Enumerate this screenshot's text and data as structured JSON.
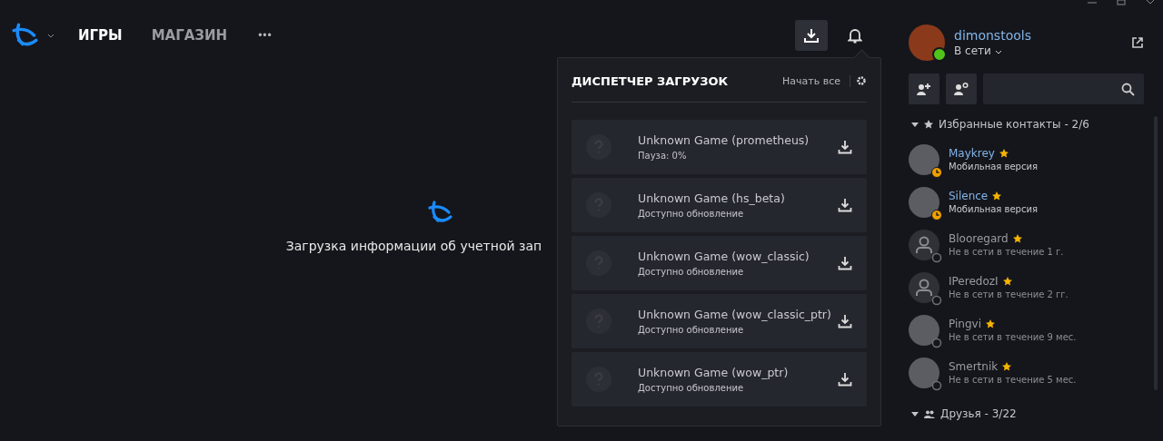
{
  "topbar": {
    "nav": [
      {
        "label": "ИГРЫ",
        "selected": true
      },
      {
        "label": "МАГАЗИН",
        "selected": false
      }
    ],
    "more": "•••"
  },
  "main": {
    "loading_text": "Загрузка информации об учетной зап"
  },
  "download_manager": {
    "title": "ДИСПЕТЧЕР ЗАГРУЗОК",
    "start_all": "Начать все",
    "items": [
      {
        "name": "Unknown Game (prometheus)",
        "status": "Пауза: 0%"
      },
      {
        "name": "Unknown Game (hs_beta)",
        "status": "Доступно обновление"
      },
      {
        "name": "Unknown Game (wow_classic)",
        "status": "Доступно обновление"
      },
      {
        "name": "Unknown Game (wow_classic_ptr)",
        "status": "Доступно обновление"
      },
      {
        "name": "Unknown Game (wow_ptr)",
        "status": "Доступно обновление"
      }
    ]
  },
  "profile": {
    "name": "dimonstools",
    "status": "В сети"
  },
  "groups": [
    {
      "kind": "favorites",
      "label": "Избранные контакты - 2/6",
      "expanded": true,
      "items": [
        {
          "name": "Maykrey",
          "mobile": true,
          "detail": "Мобильная версия",
          "photo": true
        },
        {
          "name": "Silence",
          "mobile": true,
          "detail": "Мобильная версия",
          "photo": true
        },
        {
          "name": "Blooregard",
          "mobile": false,
          "detail": "Не в сети в течение 1 г.",
          "photo": false
        },
        {
          "name": "IPeredozI",
          "mobile": false,
          "detail": "Не в сети в течение 2 гг.",
          "photo": false
        },
        {
          "name": "Pingvi",
          "mobile": false,
          "detail": "Не в сети в течение 9 мес.",
          "photo": true
        },
        {
          "name": "Smertnik",
          "mobile": false,
          "detail": "Не в сети в течение 5 мес.",
          "photo": true
        }
      ]
    },
    {
      "kind": "friends",
      "label": "Друзья - 3/22",
      "expanded": true
    }
  ]
}
